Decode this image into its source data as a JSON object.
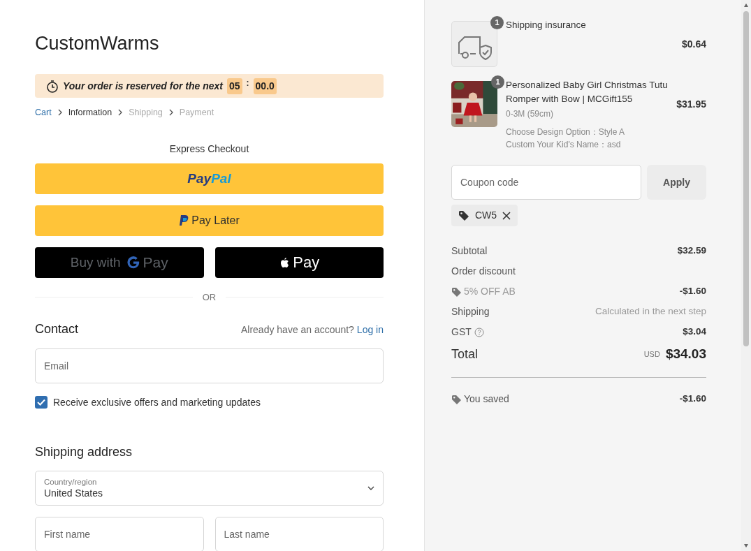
{
  "store": {
    "name": "CustomWarms"
  },
  "timer": {
    "message": "Your order is reserved for the next",
    "minutes": "05",
    "separator": ":",
    "seconds": "00.0"
  },
  "breadcrumb": [
    {
      "label": "Cart",
      "kind": "link"
    },
    {
      "label": "Information",
      "kind": "current"
    },
    {
      "label": "Shipping",
      "kind": "upcoming"
    },
    {
      "label": "Payment",
      "kind": "upcoming"
    }
  ],
  "express": {
    "title": "Express Checkout",
    "buttons": [
      {
        "kind": "paypal",
        "parts": [
          "Pay",
          "Pal"
        ]
      },
      {
        "kind": "paylater",
        "label": "Pay Later"
      },
      {
        "kind": "gpay",
        "prefix": "Buy with",
        "label": "Pay"
      },
      {
        "kind": "applepay",
        "label": "Pay"
      }
    ]
  },
  "divider": "OR",
  "contact": {
    "title": "Contact",
    "account_prompt": "Already have an account?",
    "login_link": "Log in",
    "email": {
      "placeholder": "Email"
    },
    "marketing": {
      "label": "Receive exclusive offers and marketing updates",
      "checked": true
    }
  },
  "shipping_address": {
    "title": "Shipping address",
    "country": {
      "label": "Country/region",
      "value": "United States"
    },
    "first_name": {
      "placeholder": "First name"
    },
    "last_name": {
      "placeholder": "Last name"
    }
  },
  "summary": {
    "items": [
      {
        "kind": "insurance",
        "quantity": "1",
        "title": "Shipping insurance",
        "price": "$0.64"
      },
      {
        "kind": "product",
        "quantity": "1",
        "title": "Personalized Baby Girl Christmas Tutu Romper with Bow | MCGift155",
        "variant": "0-3M (59cm)",
        "options": [
          "Choose Design Option：Style A",
          "Custom Your Kid's Name：asd"
        ],
        "price": "$31.95"
      }
    ],
    "coupon": {
      "placeholder": "Coupon code",
      "button": "Apply",
      "applied": [
        {
          "code": "CW5"
        }
      ]
    },
    "lines": [
      {
        "kind": "subtotal",
        "label": "Subtotal",
        "value": "$32.59"
      },
      {
        "kind": "heading",
        "label": "Order discount"
      },
      {
        "kind": "discount",
        "label": "5% OFF AB",
        "value": "-$1.60"
      },
      {
        "kind": "note",
        "label": "Shipping",
        "value": "Calculated in the next step"
      },
      {
        "kind": "tax",
        "label": "GST",
        "value": "$3.04"
      }
    ],
    "total": {
      "label": "Total",
      "currency": "USD",
      "value": "$34.03"
    },
    "savings": {
      "label": "You saved",
      "value": "-$1.60"
    }
  }
}
